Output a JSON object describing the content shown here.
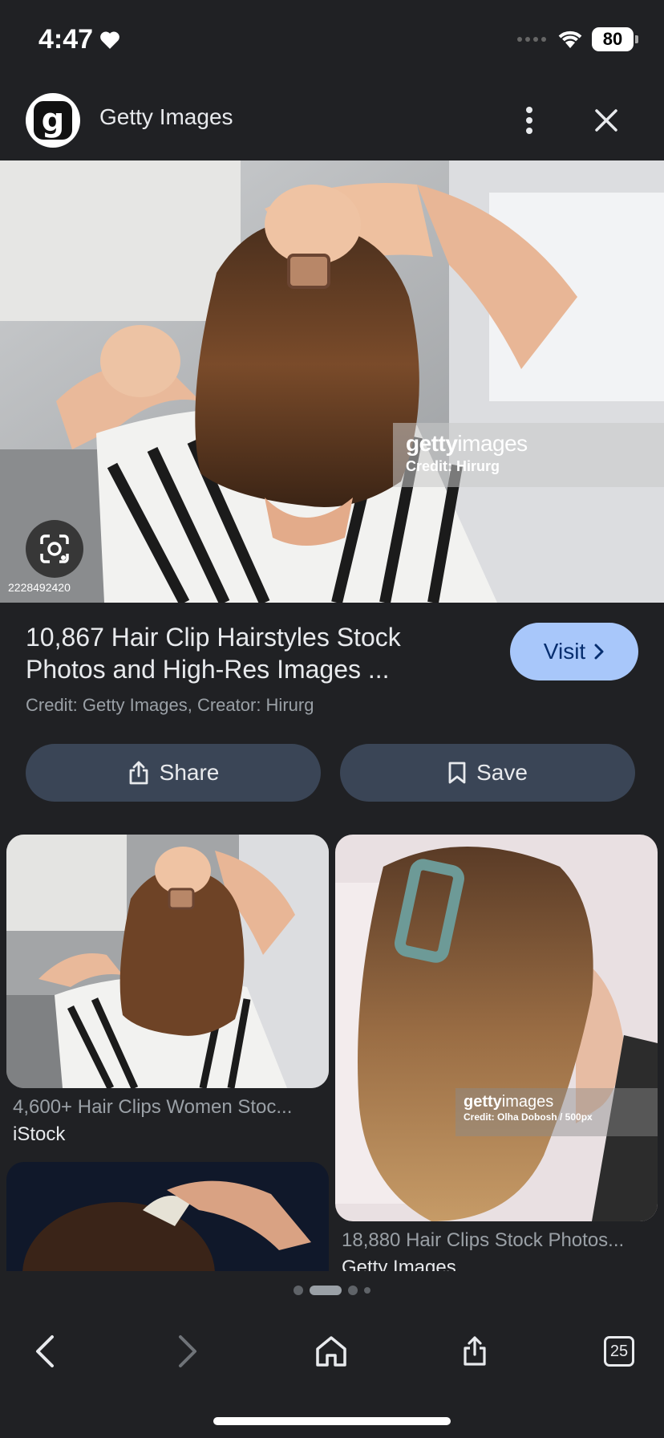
{
  "status_bar": {
    "time": "4:47",
    "battery": "80"
  },
  "header": {
    "site_logo_letter": "g",
    "site_name": "Getty Images"
  },
  "hero": {
    "image_id": "2228492420",
    "watermark_brand_bold": "getty",
    "watermark_brand_light": "images",
    "watermark_credit": "Credit: Hirurg"
  },
  "info": {
    "title": "10,867 Hair Clip Hairstyles Stock Photos and High-Res Images ...",
    "credit": "Credit: Getty Images, Creator: Hirurg",
    "visit_label": "Visit"
  },
  "actions": {
    "share_label": "Share",
    "save_label": "Save"
  },
  "results": [
    {
      "caption": "4,600+ Hair Clips Women Stoc...",
      "source": "iStock"
    },
    {
      "caption": "18,880 Hair Clips Stock Photos...",
      "source": "Getty Images",
      "watermark_brand_bold": "getty",
      "watermark_brand_light": "images",
      "watermark_credit": "Credit: Olha Dobosh / 500px"
    }
  ],
  "toolbar": {
    "tab_count": "25"
  },
  "colors": {
    "background": "#202124",
    "visit_button": "#a8c7fa",
    "action_button": "#3a4556"
  }
}
